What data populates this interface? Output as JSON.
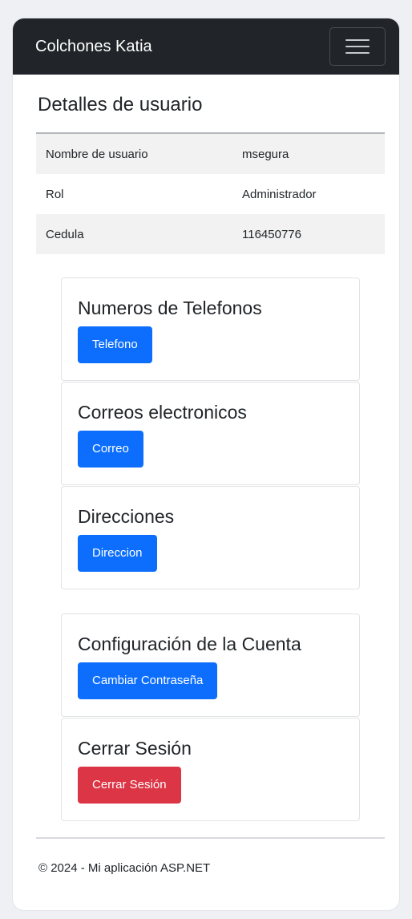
{
  "navbar": {
    "brand": "Colchones Katia",
    "toggle_icon": "hamburger-menu-icon"
  },
  "page": {
    "title": "Detalles de usuario"
  },
  "details": {
    "rows": [
      {
        "label": "Nombre de usuario",
        "value": "msegura"
      },
      {
        "label": "Rol",
        "value": "Administrador"
      },
      {
        "label": "Cedula",
        "value": "116450776"
      }
    ]
  },
  "cards": {
    "phones": {
      "title": "Numeros de Telefonos",
      "button": "Telefono"
    },
    "emails": {
      "title": "Correos electronicos",
      "button": "Correo"
    },
    "addresses": {
      "title": "Direcciones",
      "button": "Direccion"
    },
    "account": {
      "title": "Configuración de la Cuenta",
      "button": "Cambiar Contraseña"
    },
    "logout": {
      "title": "Cerrar Sesión",
      "button": "Cerrar Sesión"
    }
  },
  "footer": {
    "text": "© 2024 - Mi aplicación ASP.NET"
  },
  "colors": {
    "navbar": "#212529",
    "primary": "#0d6efd",
    "danger": "#dc3545",
    "stripe": "#f2f2f2"
  }
}
